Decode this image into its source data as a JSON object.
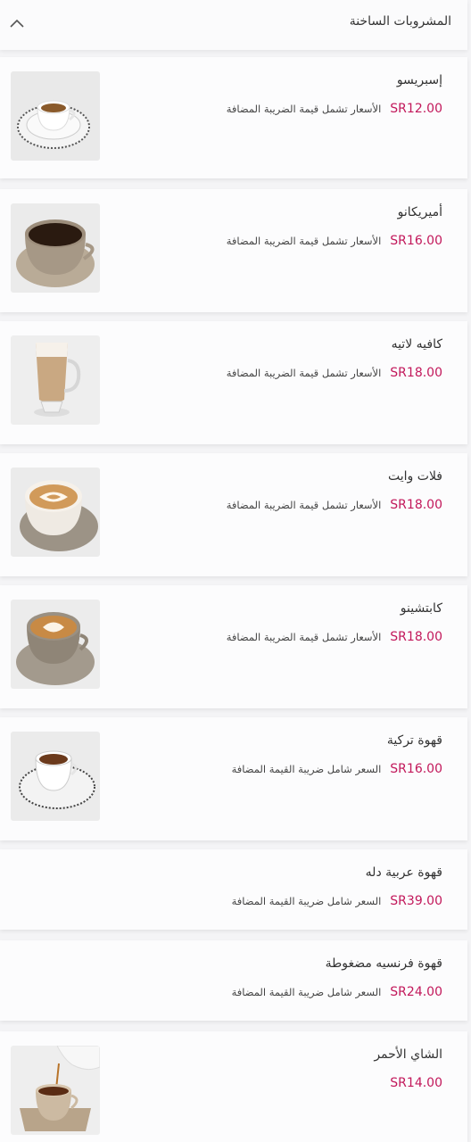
{
  "section": {
    "title": "المشروبات الساخنة",
    "icon": "chevron-up-icon"
  },
  "items": [
    {
      "name": "إسبريسو",
      "price": "SR12.00",
      "note": "الأسعار تشمل قيمة الضريبة المضافة",
      "image": "espresso-cup"
    },
    {
      "name": "أميريكانو",
      "price": "SR16.00",
      "note": "الأسعار تشمل قيمة الضريبة المضافة",
      "image": "americano-cup"
    },
    {
      "name": "كافيه لاتيه",
      "price": "SR18.00",
      "note": "الأسعار تشمل قيمة الضريبة المضافة",
      "image": "latte-glass"
    },
    {
      "name": "فلات وايت",
      "price": "SR18.00",
      "note": "الأسعار تشمل قيمة الضريبة المضافة",
      "image": "flat-white-cup"
    },
    {
      "name": "كابتشينو",
      "price": "SR18.00",
      "note": "الأسعار تشمل قيمة الضريبة المضافة",
      "image": "cappuccino-cup"
    },
    {
      "name": "قهوة تركية",
      "price": "SR16.00",
      "note": "السعر شامل ضريبة القيمة المضافة",
      "image": "turkish-coffee-cup"
    },
    {
      "name": "قهوة عربية دله",
      "price": "SR39.00",
      "note": "السعر شامل ضريبة القيمة المضافة"
    },
    {
      "name": "قهوة فرنسيه مضغوطة",
      "price": "SR24.00",
      "note": "السعر شامل ضريبة القيمة المضافة"
    },
    {
      "name": "الشاي الأحمر",
      "price": "SR14.00",
      "note": "",
      "image": "red-tea-cup"
    }
  ],
  "colors": {
    "price": "#c2185b",
    "card": "#fcfcfd",
    "background": "#f4f4f6"
  }
}
